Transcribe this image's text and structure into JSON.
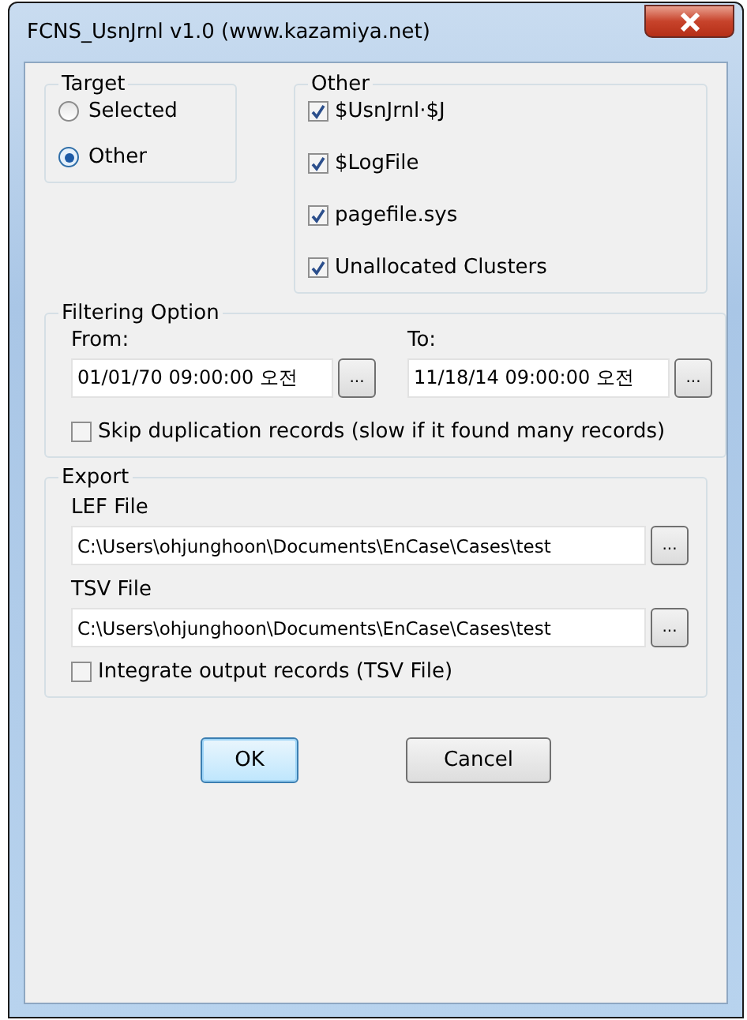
{
  "window": {
    "title": "FCNS_UsnJrnl v1.0 (www.kazamiya.net)"
  },
  "target": {
    "label": "Target",
    "options": [
      {
        "label": "Selected",
        "selected": false
      },
      {
        "label": "Other",
        "selected": true
      }
    ]
  },
  "other": {
    "label": "Other",
    "items": [
      {
        "label": "$UsnJrnl·$J",
        "checked": true
      },
      {
        "label": "$LogFile",
        "checked": true
      },
      {
        "label": "pagefile.sys",
        "checked": true
      },
      {
        "label": "Unallocated Clusters",
        "checked": true
      }
    ]
  },
  "filtering": {
    "label": "Filtering Option",
    "dates": [
      {
        "label": "From:",
        "value": "01/01/70 09:00:00 오전",
        "button": "..."
      },
      {
        "label": "To:",
        "value": "11/18/14 09:00:00 오전",
        "button": "..."
      }
    ],
    "skip": {
      "label": "Skip duplication records (slow if it found many records)",
      "checked": false
    }
  },
  "export": {
    "label": "Export",
    "files": [
      {
        "label": "LEF File",
        "value": "C:\\Users\\ohjunghoon\\Documents\\EnCase\\Cases\\test",
        "button": "..."
      },
      {
        "label": "TSV File",
        "value": "C:\\Users\\ohjunghoon\\Documents\\EnCase\\Cases\\test",
        "button": "..."
      }
    ],
    "integrate": {
      "label": "Integrate output records (TSV File)",
      "checked": false
    }
  },
  "buttons": [
    {
      "label": "OK",
      "default": true
    },
    {
      "label": "Cancel",
      "default": false
    }
  ]
}
